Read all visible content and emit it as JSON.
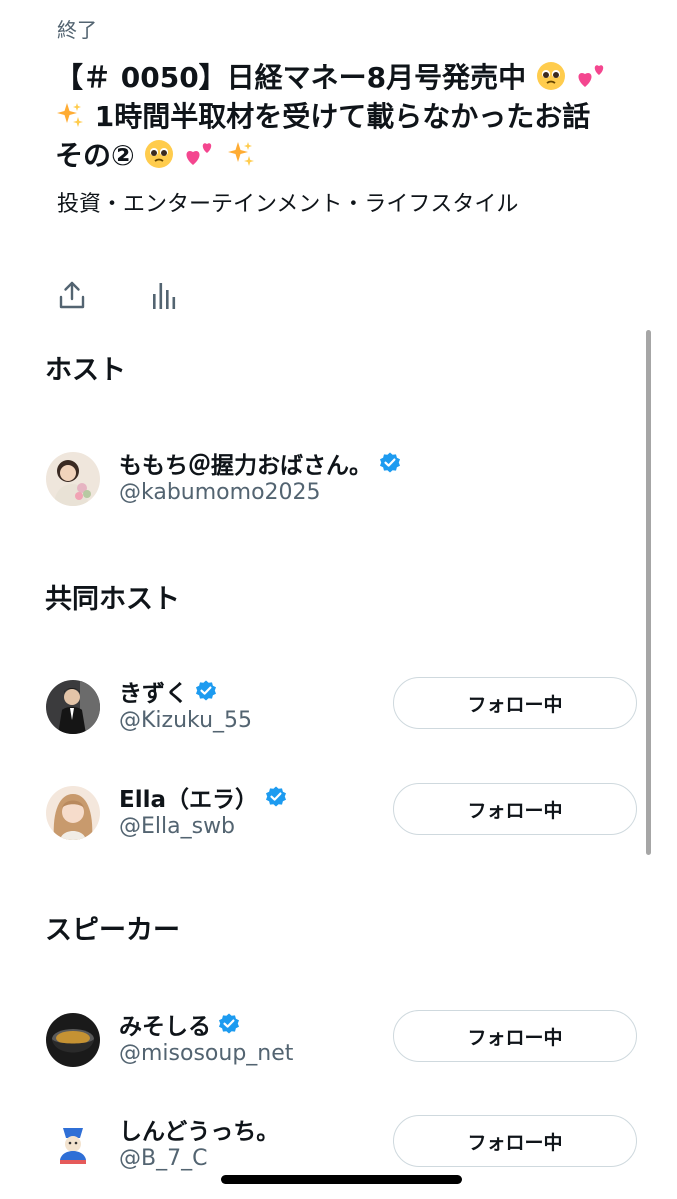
{
  "space": {
    "status": "終了",
    "title_parts": {
      "line1": "【＃ 0050】日経マネー8月号発売中",
      "line2": "1時間半取材を受けて載らなかったお話",
      "line3": "その②"
    },
    "category": "投資・エンターテインメント・ライフスタイル"
  },
  "actions": [
    {
      "icon": "share-icon"
    },
    {
      "icon": "analytics-icon"
    }
  ],
  "sections": {
    "host": {
      "title": "ホスト",
      "users": [
        {
          "name": "ももち＠握力おばさん。",
          "handle": "@kabumomo2025",
          "verified": true
        }
      ]
    },
    "cohosts": {
      "title": "共同ホスト",
      "users": [
        {
          "name": "きずく",
          "handle": "@Kizuku_55",
          "verified": true,
          "follow_label": "フォロー中"
        },
        {
          "name": "Ella（エラ）",
          "handle": "@Ella_swb",
          "verified": true,
          "follow_label": "フォロー中"
        }
      ]
    },
    "speakers": {
      "title": "スピーカー",
      "users": [
        {
          "name": "みそしる",
          "handle": "@misosoup_net",
          "verified": true,
          "follow_label": "フォロー中"
        },
        {
          "name": "しんどうっち。",
          "handle": "@B_7_C",
          "verified": false,
          "follow_label": "フォロー中"
        }
      ]
    }
  },
  "colors": {
    "text": "#0f1419",
    "secondary": "#536471",
    "verified": "#1d9bf0",
    "border": "#cfd9de"
  }
}
